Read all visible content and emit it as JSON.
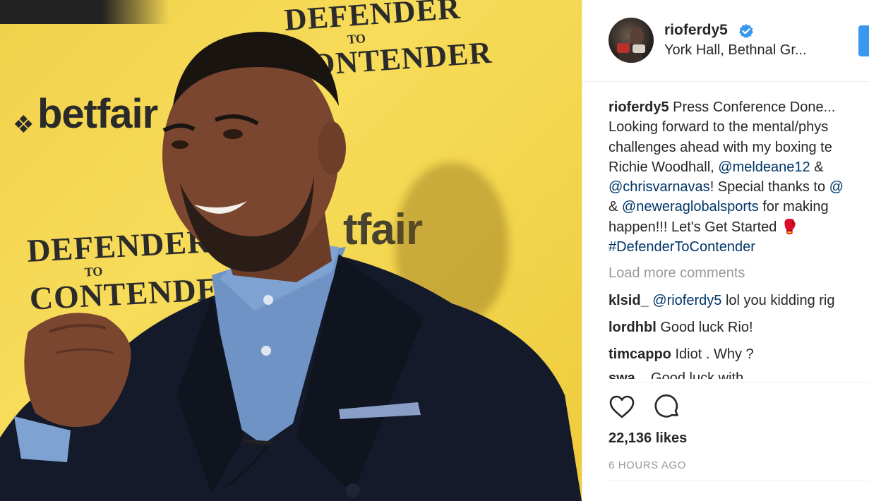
{
  "photo": {
    "brand_text": "betfair",
    "campaign_line1": "DEFENDER",
    "campaign_line2": "TO",
    "campaign_line3": "CONTENDER"
  },
  "post": {
    "username": "rioferdy5",
    "location": "York Hall, Bethnal Gr...",
    "caption": {
      "line1_text": " Press Conference Done...",
      "line2": "Looking forward to the mental/phys",
      "line3": "challenges ahead with my boxing te",
      "line4_a": "Richie Woodhall, ",
      "line4_link": "@meldeane12",
      "line4_b": " &",
      "line5_link": "@chrisvarnavas",
      "line5_b": "! Special thanks to ",
      "line5_link2": "@",
      "line6_a": "& ",
      "line6_link": "@neweraglobalsports",
      "line6_b": " for making",
      "line7": "happen!!! Let's Get Started 🥊",
      "line8_link": "#DefenderToContender"
    },
    "load_more": "Load more comments",
    "comments": [
      {
        "user": "klsid_",
        "mention": "@rioferdy5",
        "text": " lol you kidding rig"
      },
      {
        "user": "lordhbl",
        "text": "Good luck Rio!"
      },
      {
        "user": "timcappo",
        "text": "Idiot . Why ?"
      },
      {
        "user": "swa...",
        "text": "Good luck with"
      }
    ],
    "likes": "22,136 likes",
    "time": "6 HOURS AGO"
  },
  "icons": {
    "like": "heart-icon",
    "comment": "comment-icon",
    "verified": "verified-badge-icon"
  },
  "colors": {
    "link": "#003569",
    "verified": "#3897f0",
    "follow": "#3897f0",
    "muted": "#999999",
    "banner_yellow": "#f5d64e"
  }
}
